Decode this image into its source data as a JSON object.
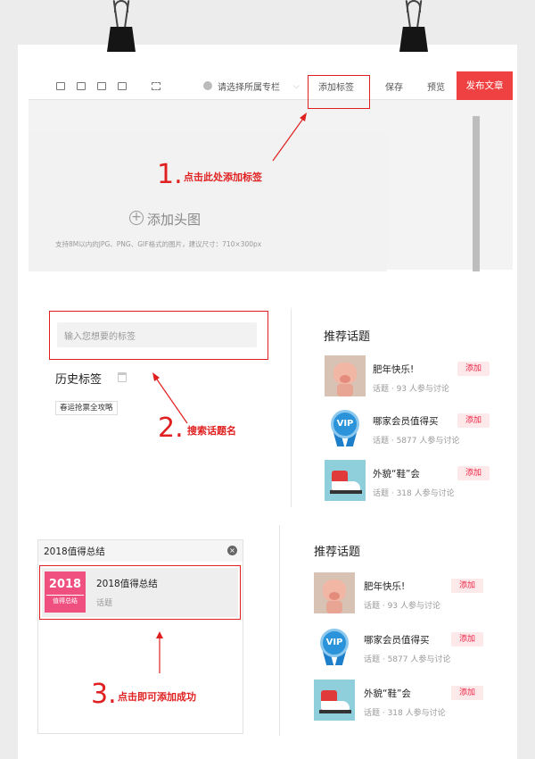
{
  "editor": {
    "category_placeholder": "请选择所属专栏",
    "add_tag": "添加标签",
    "save": "保存",
    "preview": "预览",
    "publish": "发布文章",
    "add_cover": "添加头图",
    "cover_hint": "支持8M以内的JPG、PNG、GIF格式的图片，建议尺寸：710×300px"
  },
  "steps": {
    "s1_num": "1.",
    "s1_text": "点击此处添加标签",
    "s2_num": "2.",
    "s2_text": "搜索话题名",
    "s3_num": "3.",
    "s3_text": "点击即可添加成功"
  },
  "tag_panel": {
    "input_placeholder": "输入您想要的标签",
    "history_title": "历史标签",
    "history_tags": [
      "春运抢票全攻略"
    ]
  },
  "recommend_title": "推荐话题",
  "topics": [
    {
      "name": "肥年快乐!",
      "meta": "话题 · 93 人参与讨论",
      "add": "添加",
      "icon": "pig-image"
    },
    {
      "name": "哪家会员值得买",
      "meta": "话题 · 5877 人参与讨论",
      "add": "添加",
      "icon": "vip-badge-image"
    },
    {
      "name": "外貌“鞋”会",
      "meta": "话题 · 318 人参与讨论",
      "add": "添加",
      "icon": "sneaker-image"
    }
  ],
  "search": {
    "query": "2018值得总结",
    "result_title": "2018值得总结",
    "result_type": "话题",
    "thumb_year": "2018",
    "thumb_caption": "值得总结"
  },
  "colors": {
    "accent": "#f04142",
    "annotation": "#e02020"
  }
}
